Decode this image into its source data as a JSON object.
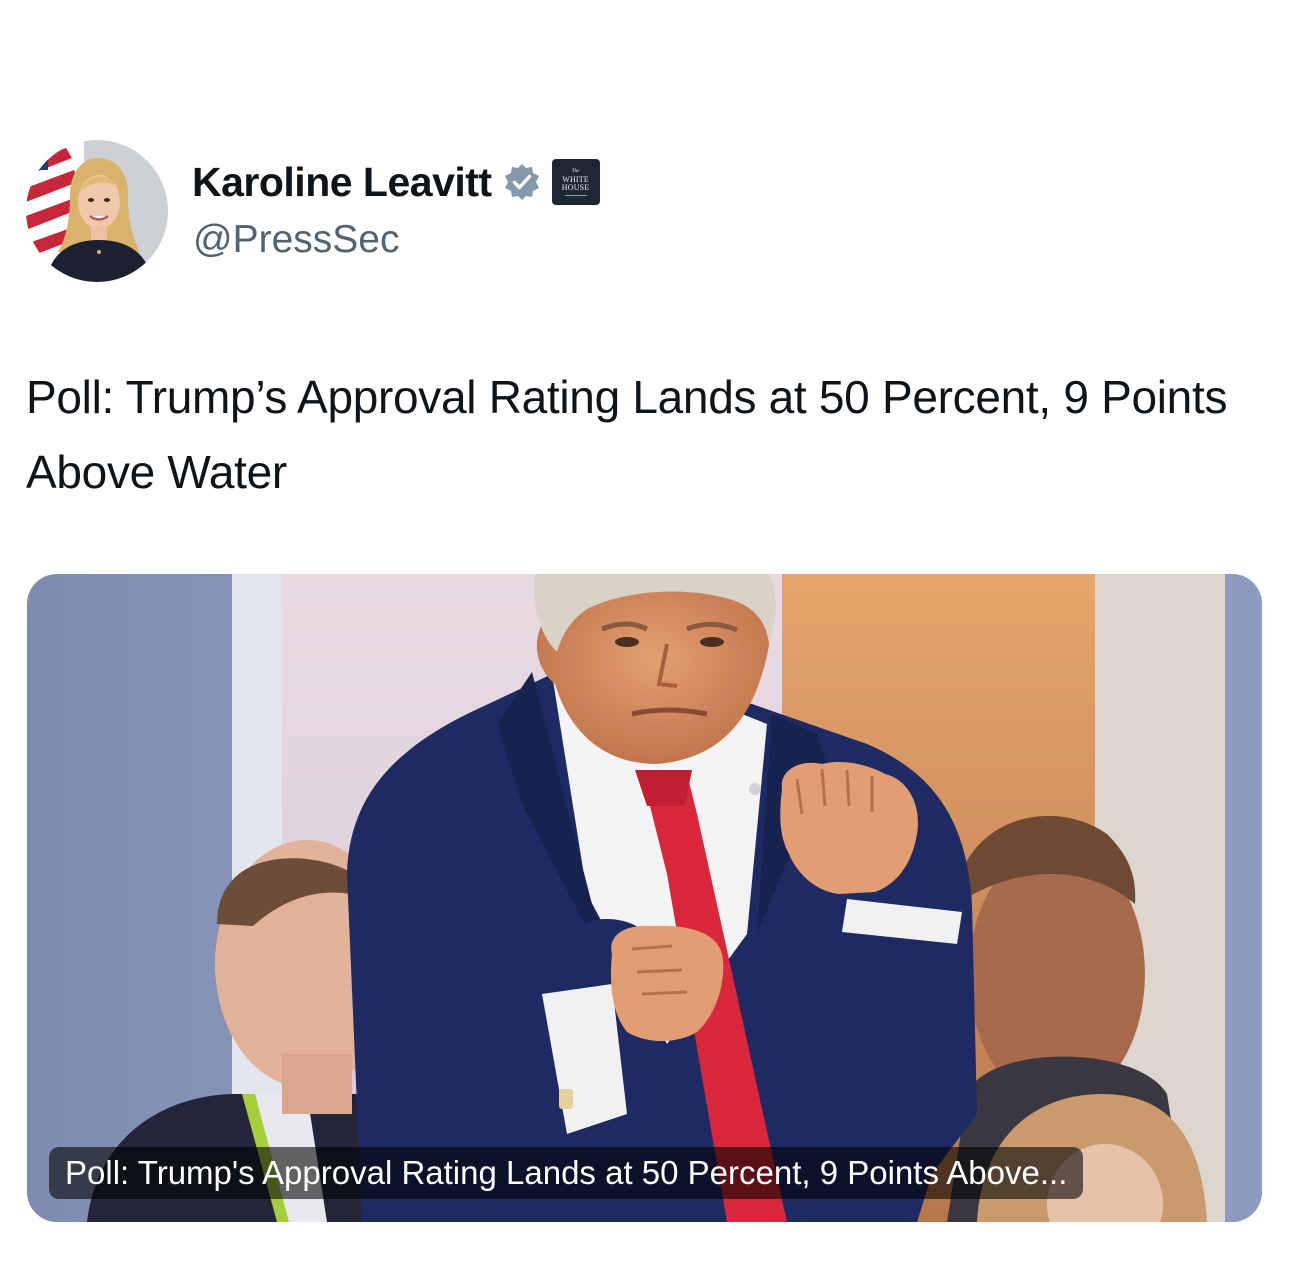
{
  "author": {
    "display_name": "Karoline Leavitt",
    "handle": "@PressSec",
    "verified_icon": "verified-badge-icon",
    "affiliation_badge": {
      "small_text": "The",
      "name_line1": "WHITE",
      "name_line2": "HOUSE"
    }
  },
  "tweet": {
    "text": "Poll: Trump’s Approval Rating Lands at 50 Percent, 9 Points Above Water"
  },
  "link_card": {
    "caption": "Poll: Trump's Approval Rating Lands at 50 Percent, 9 Points Above..."
  },
  "colors": {
    "text_primary": "#0f1419",
    "text_secondary": "#536471",
    "verified_gray": "#829aab",
    "badge_bg": "#1c2733",
    "suit_navy": "#1e2a63",
    "tie_red": "#d8263a"
  }
}
